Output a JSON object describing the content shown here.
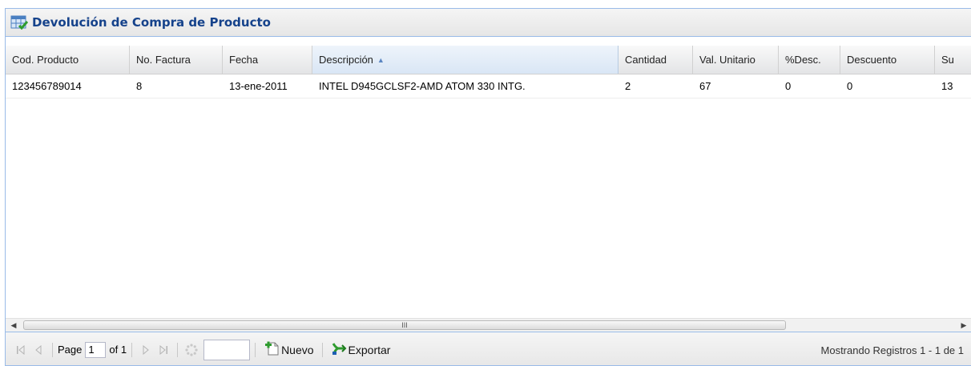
{
  "panel": {
    "title": "Devolución de Compra de Producto"
  },
  "grid": {
    "columns": [
      {
        "label": "Cod. Producto"
      },
      {
        "label": "No. Factura"
      },
      {
        "label": "Fecha"
      },
      {
        "label": "Descripción",
        "sorted": "asc"
      },
      {
        "label": "Cantidad"
      },
      {
        "label": "Val. Unitario"
      },
      {
        "label": "%Desc."
      },
      {
        "label": "Descuento"
      },
      {
        "label": "Su"
      }
    ],
    "rows": [
      [
        "123456789014",
        "8",
        "13-ene-2011",
        "INTEL D945GCLSF2-AMD ATOM 330 INTG.",
        "2",
        "67",
        "0",
        "0",
        "13"
      ]
    ]
  },
  "scrollbar": {
    "thumb_grip": "III"
  },
  "pager": {
    "page_label": "Page",
    "page_value": "1",
    "of_label": "of 1",
    "nuevo_label": "Nuevo",
    "exportar_label": "Exportar",
    "status": "Mostrando Registros 1 - 1 de 1"
  },
  "icons": {
    "panel": "grid-table-icon",
    "first": "first-page-icon",
    "prev": "prev-page-icon",
    "next": "next-page-icon",
    "last": "last-page-icon",
    "refresh": "refresh-icon",
    "nuevo": "add-document-icon",
    "exportar": "export-icon"
  },
  "colors": {
    "title": "#15428b",
    "border": "#99bbe8",
    "accent_green": "#2e9b2e"
  }
}
